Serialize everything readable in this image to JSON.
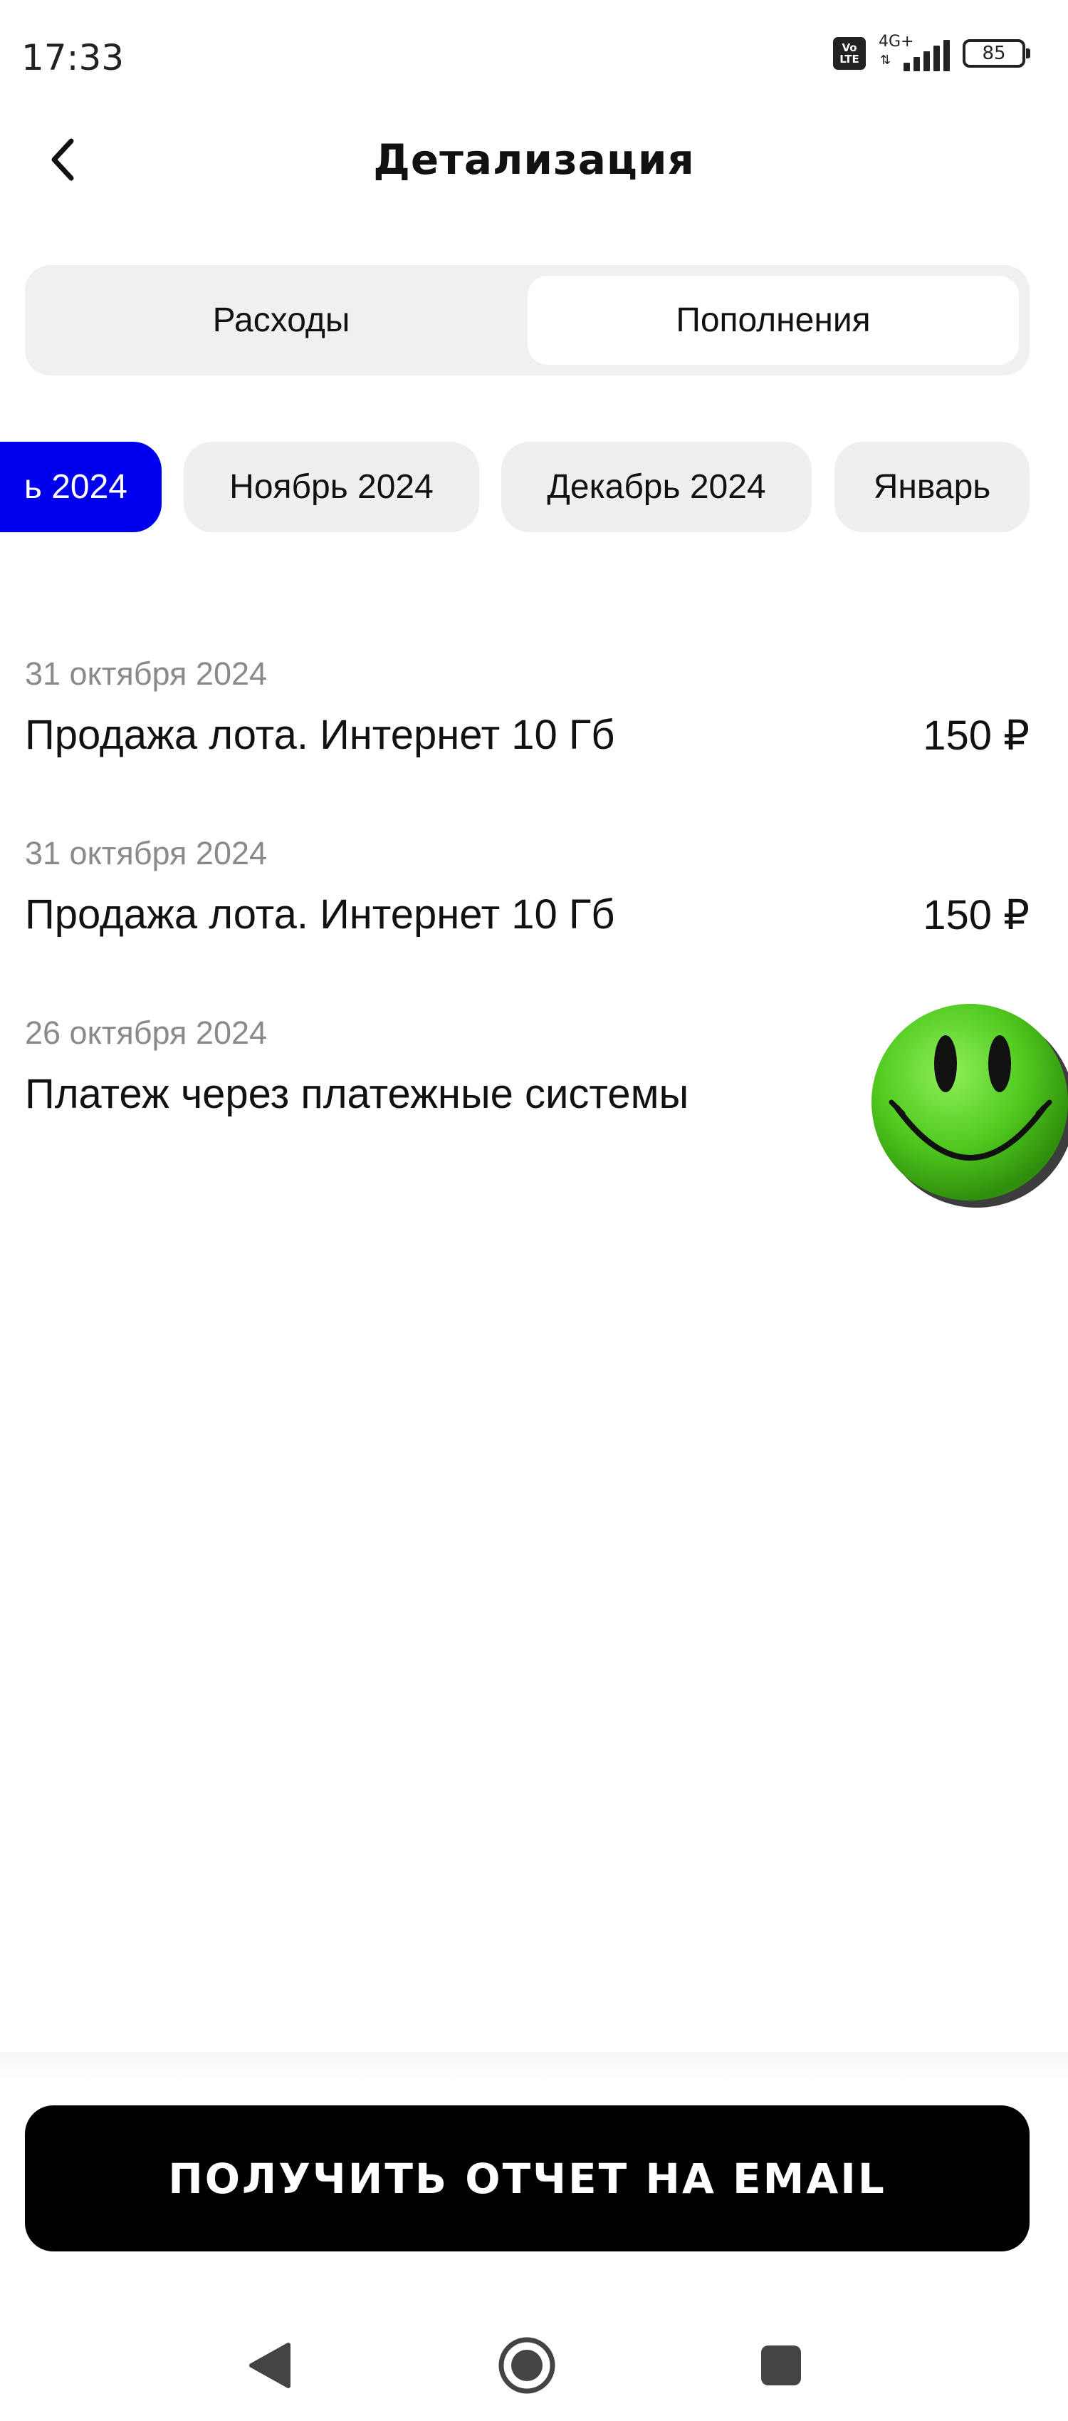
{
  "status_bar": {
    "time": "17:33",
    "volte": [
      "Vo",
      "LTE"
    ],
    "network": "4G+",
    "battery": "85"
  },
  "header": {
    "title": "Детализация",
    "back_icon": "chevron-left-icon"
  },
  "tabs": [
    {
      "label": "Расходы",
      "active": false
    },
    {
      "label": "Пополнения",
      "active": true
    }
  ],
  "months": [
    {
      "label": "ь 2024",
      "active": true
    },
    {
      "label": "Ноябрь 2024",
      "active": false
    },
    {
      "label": "Декабрь 2024",
      "active": false
    },
    {
      "label": "Январь",
      "active": false
    }
  ],
  "transactions": [
    {
      "date": "31 октября 2024",
      "title": "Продажа лота. Интернет 10 Гб",
      "amount": "150 ₽"
    },
    {
      "date": "31 октября 2024",
      "title": "Продажа лота. Интернет 10 Гб",
      "amount": "150 ₽"
    },
    {
      "date": "26 октября 2024",
      "title": "Платеж через платежные системы",
      "amount": ""
    }
  ],
  "email_button": {
    "label": "ПОЛУЧИТЬ ОТЧЕТ НА EMAIL"
  },
  "colors": {
    "accent": "#0000ee",
    "chip_bg": "#efefef",
    "button_bg": "#000000",
    "muted_text": "#8a8a8a"
  },
  "icons": {
    "overlay": "smiley-face-icon",
    "nav": [
      "nav-back-icon",
      "nav-home-icon",
      "nav-recents-icon"
    ]
  }
}
